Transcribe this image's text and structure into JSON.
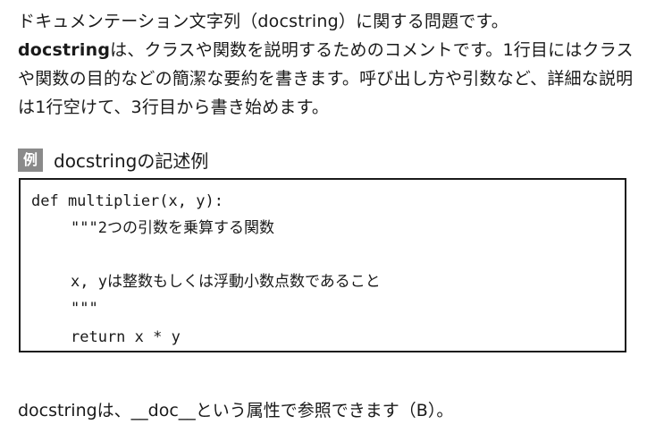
{
  "intro": {
    "line1": "ドキュメンテーション文字列（docstring）に関する問題です。",
    "line2_bold": "docstring",
    "line2_rest": "は、クラスや関数を説明するためのコメントです。1行目にはクラスや関数の目的などの簡潔な要約を書きます。呼び出し方や引数など、詳細な説明は1行空けて、3行目から書き始めます。"
  },
  "example": {
    "badge": "例",
    "title": "docstringの記述例"
  },
  "code": {
    "line1": "def multiplier(x, y):",
    "line2": "\"\"\"2つの引数を乗算する関数",
    "line3": "x, yは整数もしくは浮動小数点数であること",
    "line4": "\"\"\"",
    "line5": "return x * y"
  },
  "footer": {
    "text": "docstringは、__doc__という属性で参照できます（B）。"
  }
}
